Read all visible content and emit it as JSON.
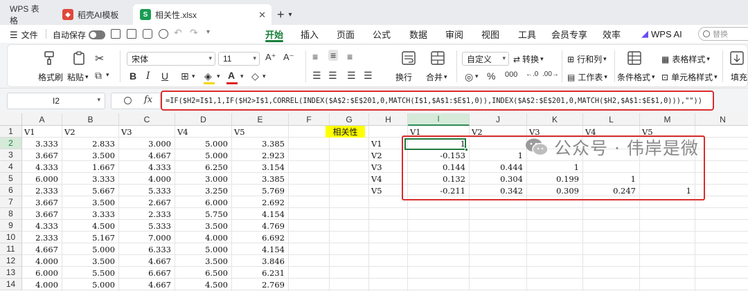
{
  "tabs": [
    {
      "label": "WPS 表格"
    },
    {
      "label": "稻壳AI模板"
    },
    {
      "label": "相关性.xlsx"
    }
  ],
  "menu": {
    "file": "文件",
    "autosave": "自动保存",
    "ribbon_tabs": [
      "开始",
      "插入",
      "页面",
      "公式",
      "数据",
      "审阅",
      "视图",
      "工具",
      "会员专享",
      "效率",
      "WPS AI"
    ],
    "active_tab": "开始",
    "search_placeholder": "替换"
  },
  "ribbon": {
    "format_painter": "格式刷",
    "paste": "粘贴",
    "font_name": "宋体",
    "font_size": "11",
    "wrap": "换行",
    "merge": "合并",
    "number_format": "自定义",
    "convert": "转换",
    "rows_cols": "行和列",
    "worksheet": "工作表",
    "cond_format": "条件格式",
    "table_style": "表格样式",
    "cell_style": "单元格样式",
    "fill": "填充"
  },
  "formula_bar": {
    "name_box": "I2",
    "fx": "fx",
    "formula": "=IF($H2=I$1,1,IF($H2>I$1,CORREL(INDEX($A$2:$E$201,0,MATCH(I$1,$A$1:$E$1,0)),INDEX($A$2:$E$201,0,MATCH($H2,$A$1:$E$1,0))),\"\"))"
  },
  "grid": {
    "columns": [
      "A",
      "B",
      "C",
      "D",
      "E",
      "F",
      "G",
      "H",
      "I",
      "J",
      "K",
      "L",
      "M",
      "N"
    ],
    "selected_column": "I",
    "rows": [
      "1",
      "2",
      "3",
      "4",
      "5",
      "6",
      "7",
      "8",
      "9",
      "10",
      "11",
      "12",
      "13",
      "14"
    ],
    "selected_row": "2",
    "headers": [
      "V1",
      "V2",
      "V3",
      "V4",
      "V5"
    ],
    "data": [
      [
        "3.333",
        "2.833",
        "3.000",
        "5.000",
        "3.385"
      ],
      [
        "3.667",
        "3.500",
        "4.667",
        "5.000",
        "2.923"
      ],
      [
        "4.333",
        "1.667",
        "4.333",
        "6.250",
        "3.154"
      ],
      [
        "6.000",
        "3.333",
        "4.000",
        "3.000",
        "3.385"
      ],
      [
        "2.333",
        "5.667",
        "5.333",
        "3.250",
        "5.769"
      ],
      [
        "3.667",
        "3.500",
        "2.667",
        "6.000",
        "2.692"
      ],
      [
        "3.667",
        "3.333",
        "2.333",
        "5.750",
        "4.154"
      ],
      [
        "4.333",
        "4.500",
        "5.333",
        "3.500",
        "4.769"
      ],
      [
        "2.333",
        "5.167",
        "7.000",
        "4.000",
        "6.692"
      ],
      [
        "4.667",
        "5.000",
        "6.333",
        "5.000",
        "4.154"
      ],
      [
        "4.000",
        "3.500",
        "4.667",
        "3.500",
        "3.846"
      ],
      [
        "6.000",
        "5.500",
        "6.667",
        "6.500",
        "6.231"
      ],
      [
        "4.000",
        "5.000",
        "4.667",
        "4.500",
        "2.769"
      ]
    ],
    "g1_label": "相关性",
    "corr_row_labels": [
      "V1",
      "V2",
      "V3",
      "V4",
      "V5"
    ],
    "corr_col_labels": [
      "V1",
      "V2",
      "V3",
      "V4",
      "V5"
    ],
    "corr": [
      [
        "1",
        "",
        "",
        "",
        ""
      ],
      [
        "-0.153",
        "1",
        "",
        "",
        ""
      ],
      [
        "0.144",
        "0.444",
        "1",
        "",
        ""
      ],
      [
        "0.132",
        "0.304",
        "0.199",
        "1",
        ""
      ],
      [
        "-0.211",
        "0.342",
        "0.309",
        "0.247",
        "1"
      ]
    ]
  },
  "watermark": "公众号 · 伟岸是微"
}
